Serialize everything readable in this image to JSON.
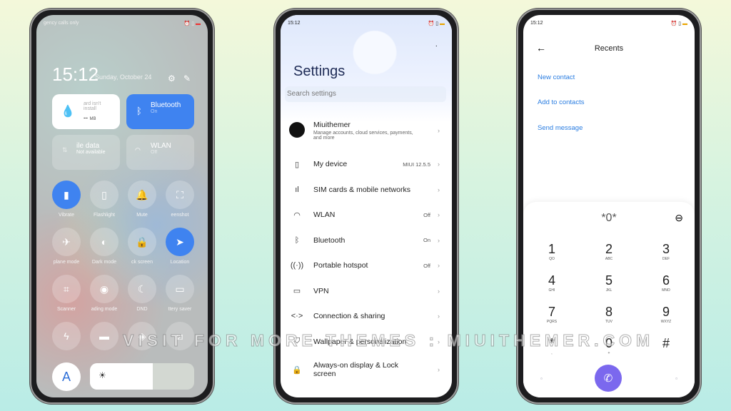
{
  "control_center": {
    "status_left": "gency calls only",
    "time": "15:12",
    "date": "Sunday, October 24",
    "data_tile": {
      "title": "ard isn't install",
      "value": "--",
      "unit": "MB"
    },
    "bluetooth_tile": {
      "title": "Bluetooth",
      "state": "On"
    },
    "mobile_tile": {
      "title": "ile data",
      "state": "Not available"
    },
    "wlan_tile": {
      "title": "WLAN",
      "state": "Off"
    },
    "toggles": [
      {
        "label": "Vibrate",
        "icon": "vibrate-icon",
        "on": true
      },
      {
        "label": "Flashlight",
        "icon": "flashlight-icon",
        "on": false
      },
      {
        "label": "Mute",
        "icon": "bell-icon",
        "on": false
      },
      {
        "label": "eenshot",
        "icon": "screenshot-icon",
        "on": false
      },
      {
        "label": "plane mode",
        "icon": "airplane-icon",
        "on": false
      },
      {
        "label": "Dark mode",
        "icon": "dark-mode-icon",
        "on": false
      },
      {
        "label": "ck screen",
        "icon": "lock-icon",
        "on": false
      },
      {
        "label": "Location",
        "icon": "location-icon",
        "on": true
      },
      {
        "label": "Scanner",
        "icon": "scanner-icon",
        "on": false
      },
      {
        "label": "ading mode",
        "icon": "eye-icon",
        "on": false
      },
      {
        "label": "DND",
        "icon": "moon-icon",
        "on": false
      },
      {
        "label": "ttery saver",
        "icon": "battery-icon",
        "on": false
      },
      {
        "label": "",
        "icon": "bolt-icon",
        "on": false
      },
      {
        "label": "",
        "icon": "cast-icon",
        "on": false
      },
      {
        "label": "",
        "icon": "diamond-icon",
        "on": false
      },
      {
        "label": "",
        "icon": "rotate-icon",
        "on": false
      }
    ],
    "auto_brightness": "A",
    "brightness_percent": 60,
    "accent": "#3f83f0"
  },
  "settings": {
    "time": "15:12",
    "title": "Settings",
    "search_placeholder": "Search settings",
    "account": {
      "name": "Miuithemer",
      "subtitle": "Manage accounts, cloud services, payments, and more"
    },
    "items": [
      {
        "label": "My device",
        "value": "MIUI 12.5.5",
        "icon": "phone-icon"
      },
      {
        "label": "SIM cards & mobile networks",
        "value": "",
        "icon": "signal-icon"
      },
      {
        "label": "WLAN",
        "value": "Off",
        "icon": "wifi-icon"
      },
      {
        "label": "Bluetooth",
        "value": "On",
        "icon": "bluetooth-icon"
      },
      {
        "label": "Portable hotspot",
        "value": "Off",
        "icon": "hotspot-icon"
      },
      {
        "label": "VPN",
        "value": "",
        "icon": "vpn-icon"
      },
      {
        "label": "Connection & sharing",
        "value": "",
        "icon": "connection-icon"
      },
      {
        "label": "Wallpaper & personalization",
        "value": "",
        "icon": "shirt-icon"
      },
      {
        "label": "Always-on display & Lock screen",
        "value": "",
        "icon": "lock-icon"
      }
    ]
  },
  "dialer": {
    "time": "15:12",
    "title": "Recents",
    "links": [
      "New contact",
      "Add to contacts",
      "Send message"
    ],
    "number": "*0*",
    "keys": [
      {
        "n": "1",
        "s": "QO"
      },
      {
        "n": "2",
        "s": "ABC"
      },
      {
        "n": "3",
        "s": "DEF"
      },
      {
        "n": "4",
        "s": "GHI"
      },
      {
        "n": "5",
        "s": "JKL"
      },
      {
        "n": "6",
        "s": "MNO"
      },
      {
        "n": "7",
        "s": "PQRS"
      },
      {
        "n": "8",
        "s": "TUV"
      },
      {
        "n": "9",
        "s": "WXYZ"
      },
      {
        "n": "*",
        "s": ","
      },
      {
        "n": "0",
        "s": "+"
      },
      {
        "n": "#",
        "s": ""
      }
    ],
    "call_color": "#7b68ee"
  },
  "watermark": "VISIT FOR MORE THEMES : MIUITHEMER.COM"
}
